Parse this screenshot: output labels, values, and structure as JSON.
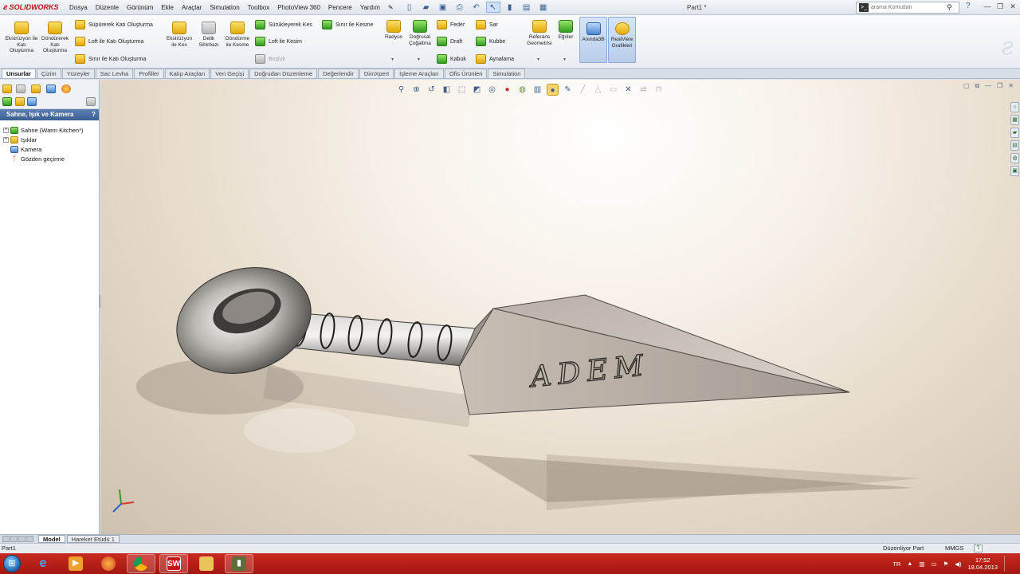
{
  "app": {
    "logo": "SOLIDWORKS",
    "document_title": "Part1 *",
    "menu": [
      "Dosya",
      "Düzenle",
      "Görünüm",
      "Ekle",
      "Araçlar",
      "Simulation",
      "Toolbox",
      "PhotoView 360",
      "Pencere",
      "Yardım"
    ],
    "search_placeholder": "arama Komutları"
  },
  "ribbon": {
    "extrude": "Ekstrüzyon İle Katı Oluşturma",
    "revolve": "Döndürerek Katı Oluşturma",
    "sweep": "Süpürerek Katı Oluşturma",
    "loft": "Loft ile Katı Oluşturma",
    "boundary": "Sınır ile Katı Oluşturma",
    "extrude_cut": "Ekstrüzyon ile Kes",
    "hole_wizard": "Delik Sihirbazı",
    "revolve_cut": "Döndürme ile Kesme",
    "sweep_cut": "Sürükleyerek Kes",
    "loft_cut": "Loft ile Kesim",
    "boundary_cut": "Sınır ile Kesme",
    "void": "Boşluk",
    "fillet": "Radyus",
    "linear_pattern": "Doğrusal Çoğaltma",
    "rib": "Feder",
    "draft": "Draft",
    "shell": "Kabuk",
    "wrap": "Sar",
    "dome": "Kubbe",
    "mirror": "Aynalama",
    "ref_geometry": "Referans Geometrisi",
    "curves": "Eğriler",
    "instant3d": "Anında3B",
    "realview": "RealView Grafikleri"
  },
  "tabs": [
    "Unsurlar",
    "Çizim",
    "Yüzeyler",
    "Sac Levha",
    "Profiller",
    "Kalıp Araçları",
    "Veri Geçişi",
    "Doğrudan Düzenleme",
    "Değerlendir",
    "DimXpert",
    "İşleme Araçları",
    "Ofis Ürünleri",
    "Simulation"
  ],
  "left_panel": {
    "title": "Sahne, Işık ve Kamera",
    "help": "?",
    "tree": [
      {
        "label": "Sahne (Warm Kitchen*)",
        "expandable": true
      },
      {
        "label": "Işıklar",
        "expandable": true
      },
      {
        "label": "Kamera",
        "expandable": false
      },
      {
        "label": "Gözden geçirme",
        "expandable": false
      }
    ]
  },
  "model": {
    "engraving": "ADEM"
  },
  "bottom_tabs": [
    "Model",
    "Hareket Etüdü 1"
  ],
  "status": {
    "left": "Part1",
    "mode": "Düzenliyor Part",
    "units": "MMGS",
    "help": "?"
  },
  "taskbar": {
    "lang": "TR",
    "time": "17:52",
    "date": "18.04.2013"
  },
  "colors": {
    "accent": "#3c5f92",
    "taskbar": "#b81e15",
    "logo": "#b8141b"
  }
}
